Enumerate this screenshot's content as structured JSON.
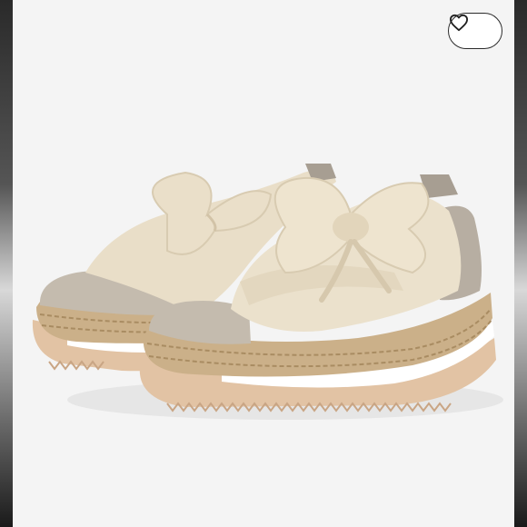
{
  "product_image": {
    "subject": "espadrille-sneakers"
  },
  "like_button": {
    "icon": "heart-icon"
  },
  "colors": {
    "photo_background": "#f4f4f4",
    "canvas_fabric": "#ede3cf",
    "suede": "#bfb5a8",
    "jute": "#c9ad84",
    "outsole": "#e3c4a6",
    "midsole_white": "#ffffff",
    "button_border": "#2b2b2b"
  }
}
